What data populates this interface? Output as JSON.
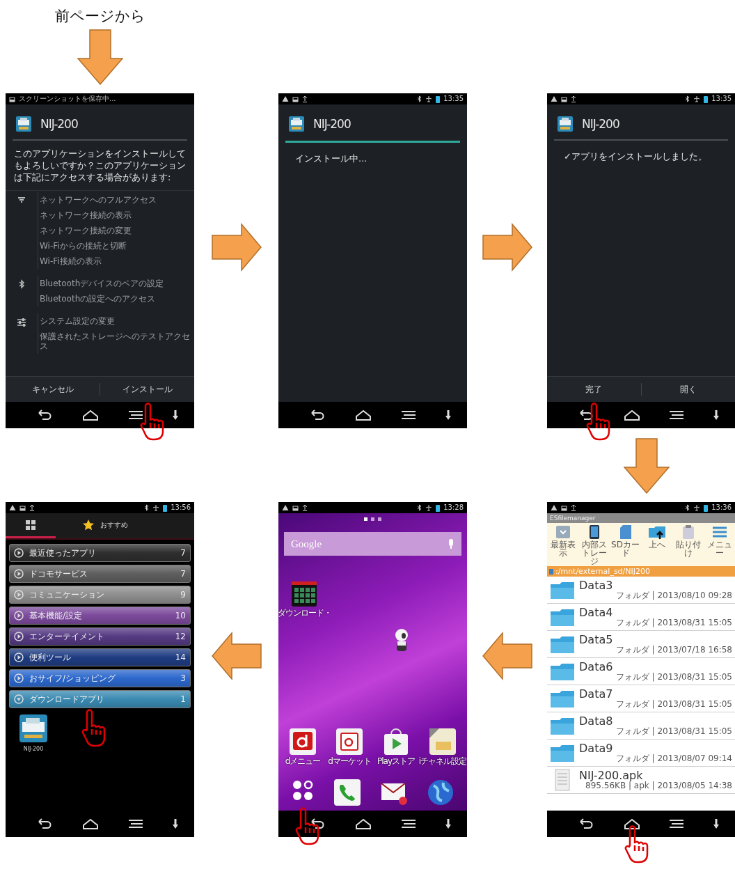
{
  "caption": "前ページから",
  "top_row": [
    {
      "kind": "install_confirm",
      "status": {
        "ticker": "スクリーンショットを保存中..."
      },
      "title": "NIJ-200",
      "message": "このアプリケーションをインストールしてもよろしいですか？このアプリケーションは下記にアクセスする場合があります:",
      "permission_groups": [
        {
          "kind": "network",
          "items": [
            "ネットワークへのフルアクセス",
            "ネットワーク接続の表示",
            "ネットワーク接続の変更",
            "Wi-Fiからの接続と切断",
            "Wi-Fi接続の表示"
          ]
        },
        {
          "kind": "bluetooth",
          "items": [
            "Bluetoothデバイスのペアの設定",
            "Bluetoothの設定へのアクセス"
          ]
        },
        {
          "kind": "settings",
          "items": [
            "システム設定の変更",
            "保護されたストレージへのテストアクセス"
          ]
        }
      ],
      "buttons": [
        {
          "label": "キャンセル",
          "tapped": false
        },
        {
          "label": "インストール",
          "tapped": true
        }
      ]
    },
    {
      "kind": "installing",
      "status": {
        "time": "13:35"
      },
      "title": "NIJ-200",
      "progress": {
        "level": 1
      },
      "message": "インストール中..."
    },
    {
      "kind": "installed",
      "status": {
        "time": "13:35"
      },
      "title": "NIJ-200",
      "message": "✓アプリをインストールしました。",
      "buttons": [
        {
          "label": "完了",
          "tapped": true
        },
        {
          "label": "開く",
          "tapped": false
        }
      ]
    }
  ],
  "bottom_row": [
    {
      "kind": "app_drawer",
      "status": {
        "time": "13:56"
      },
      "tabs": [
        {
          "kind": "grid",
          "selected": true
        },
        {
          "kind": "star",
          "label": "おすすめ",
          "selected": false
        }
      ],
      "categories": [
        {
          "label": "最近使ったアプリ",
          "count": "7",
          "color": "#2e2e2e",
          "expanded": false,
          "tapped": false
        },
        {
          "label": "ドコモサービス",
          "count": "7",
          "color": "#5e5e5e",
          "expanded": false,
          "tapped": false
        },
        {
          "label": "コミュニケーション",
          "count": "9",
          "color": "#8e8e8e",
          "expanded": false,
          "tapped": false
        },
        {
          "label": "基本機能/設定",
          "count": "10",
          "color": "#7c4a9c",
          "expanded": false,
          "tapped": false
        },
        {
          "label": "エンターテイメント",
          "count": "12",
          "color": "#553a82",
          "expanded": false,
          "tapped": false
        },
        {
          "label": "便利ツール",
          "count": "14",
          "color": "#1f3c82",
          "expanded": false,
          "tapped": false
        },
        {
          "label": "おサイフ/ショッピング",
          "count": "3",
          "color": "#2c68cc",
          "expanded": false,
          "tapped": false
        },
        {
          "label": "ダウンロードアプリ",
          "count": "1",
          "color": "#3a8ab2",
          "expanded": true,
          "tapped": true
        }
      ],
      "apps": [
        {
          "label": "NIJ-200"
        }
      ]
    },
    {
      "kind": "home",
      "status": {
        "time": "13:28"
      },
      "page_dots": [
        {
          "selected": true
        },
        {
          "selected": false
        },
        {
          "selected": false
        }
      ],
      "search": {
        "logo": "Google"
      },
      "desktop_icons": [
        {
          "label": "ダウンロード・"
        }
      ],
      "apps": [
        {
          "kind": "dmenu",
          "label": "dメニュー"
        },
        {
          "kind": "dmarket",
          "label": "dマーケット"
        },
        {
          "kind": "play",
          "label": "Playストア"
        },
        {
          "kind": "ichannel",
          "label": "iチャネル設定"
        }
      ],
      "dock": [
        {
          "kind": "apps",
          "tapped": true
        },
        {
          "kind": "phone",
          "tapped": false
        },
        {
          "kind": "mail",
          "tapped": false
        },
        {
          "kind": "browser",
          "tapped": false
        }
      ]
    },
    {
      "kind": "file_manager",
      "status": {
        "time": "13:36"
      },
      "app_title": "ESfilemanager",
      "toolbar": [
        {
          "kind": "tray",
          "label": "最新表示"
        },
        {
          "kind": "phone",
          "label": "内部ストレージ"
        },
        {
          "kind": "sd",
          "label": "SDカード"
        },
        {
          "kind": "up",
          "label": "上へ"
        },
        {
          "kind": "clipboard",
          "label": "貼り付け"
        },
        {
          "kind": "menu",
          "label": "メニュー"
        }
      ],
      "path": ":/mnt/external_sd/NIJ200",
      "files": [
        {
          "kind": "folder",
          "name": "Data3",
          "meta": "フォルダ | 2013/08/10 09:28"
        },
        {
          "kind": "folder",
          "name": "Data4",
          "meta": "フォルダ | 2013/08/31 15:05"
        },
        {
          "kind": "folder",
          "name": "Data5",
          "meta": "フォルダ | 2013/07/18 16:58"
        },
        {
          "kind": "folder",
          "name": "Data6",
          "meta": "フォルダ | 2013/08/31 15:05"
        },
        {
          "kind": "folder",
          "name": "Data7",
          "meta": "フォルダ | 2013/08/31 15:05"
        },
        {
          "kind": "folder",
          "name": "Data8",
          "meta": "フォルダ | 2013/08/31 15:05"
        },
        {
          "kind": "folder",
          "name": "Data9",
          "meta": "フォルダ | 2013/08/07 09:14"
        },
        {
          "kind": "file",
          "name": "NIJ-200.apk",
          "meta": "895.56KB | apk | 2013/08/05 14:38"
        }
      ],
      "home_key_tapped": true
    }
  ]
}
